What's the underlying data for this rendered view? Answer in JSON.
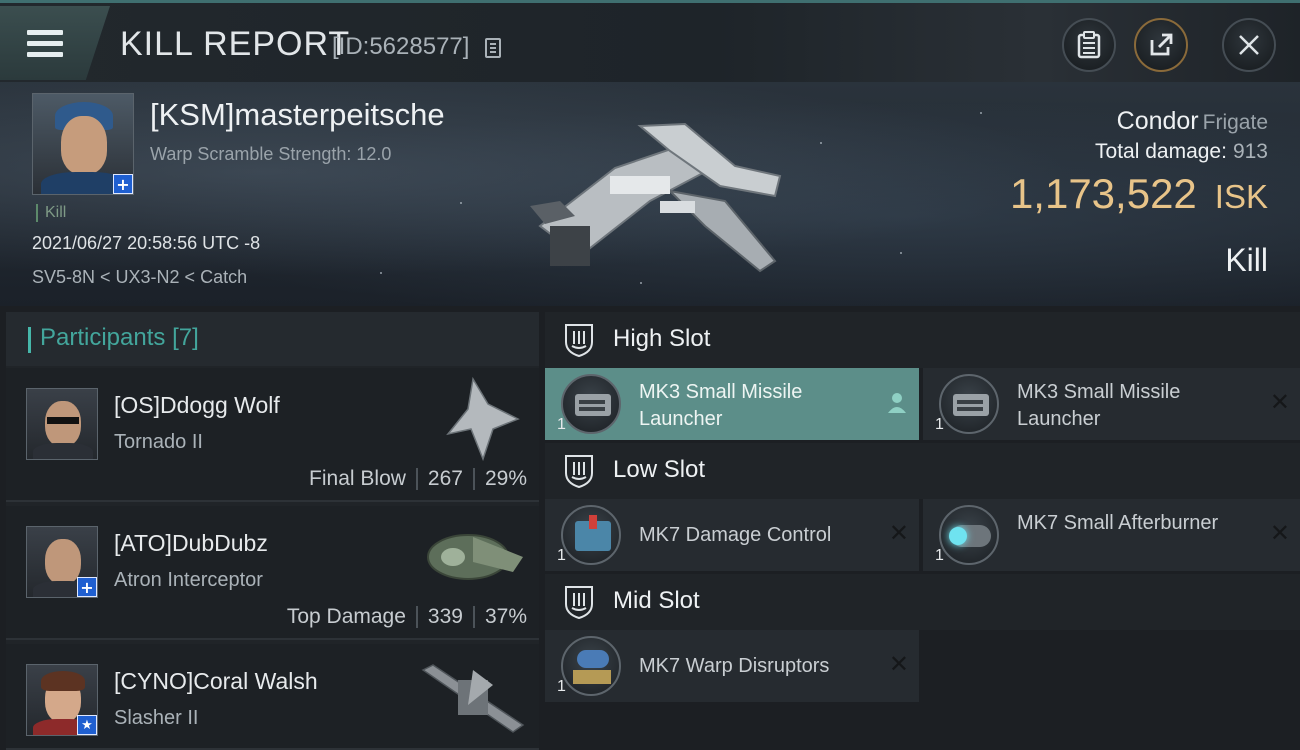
{
  "header": {
    "title": "KILL REPORT",
    "report_id": "[ID:5628577]"
  },
  "victim": {
    "name": "[KSM]masterpeitsche",
    "warp_scramble": "Warp Scramble Strength: 12.0",
    "kill_tag": "Kill",
    "timestamp": "2021/06/27 20:58:56 UTC -8",
    "location": "SV5-8N < UX3-N2 < Catch",
    "ship_name": "Condor",
    "ship_class": "Frigate",
    "total_damage_label": "Total damage:",
    "total_damage": "913",
    "isk_value": "1,173,522",
    "isk_unit": "ISK",
    "result": "Kill"
  },
  "participants": {
    "label": "Participants",
    "count": "[7]",
    "rows": [
      {
        "name": "[OS]Ddogg Wolf",
        "ship": "Tornado II",
        "role": "Final Blow",
        "damage": "267",
        "percent": "29%"
      },
      {
        "name": "[ATO]DubDubz",
        "ship": "Atron Interceptor",
        "role": "Top Damage",
        "damage": "339",
        "percent": "37%"
      },
      {
        "name": "[CYNO]Coral Walsh",
        "ship": "Slasher II"
      }
    ]
  },
  "slots": {
    "high": {
      "label": "High Slot",
      "modules": [
        {
          "name": "MK3 Small Missile Launcher",
          "qty": "1"
        },
        {
          "name": "MK3 Small Missile Launcher",
          "qty": "1"
        }
      ]
    },
    "low": {
      "label": "Low Slot",
      "modules": [
        {
          "name": "MK7 Damage Control",
          "qty": "1"
        },
        {
          "name": "MK7 Small Afterburner",
          "qty": "1"
        }
      ]
    },
    "mid": {
      "label": "Mid Slot",
      "modules": [
        {
          "name": "MK7 Warp Disruptors",
          "qty": "1"
        }
      ]
    }
  },
  "icons": {
    "menu": "hamburger-menu-icon",
    "copy": "copy-icon",
    "clipboard": "clipboard-icon",
    "share": "share-icon",
    "close": "close-icon",
    "slot": "slot-shield-icon",
    "remove": "x-icon",
    "pilot": "person-icon"
  },
  "colors": {
    "accent_teal": "#46b7aa",
    "isk_gold": "#e8c489",
    "highlight_row": "#5c8e89",
    "corp_badge_blue": "#1f5fd0"
  }
}
